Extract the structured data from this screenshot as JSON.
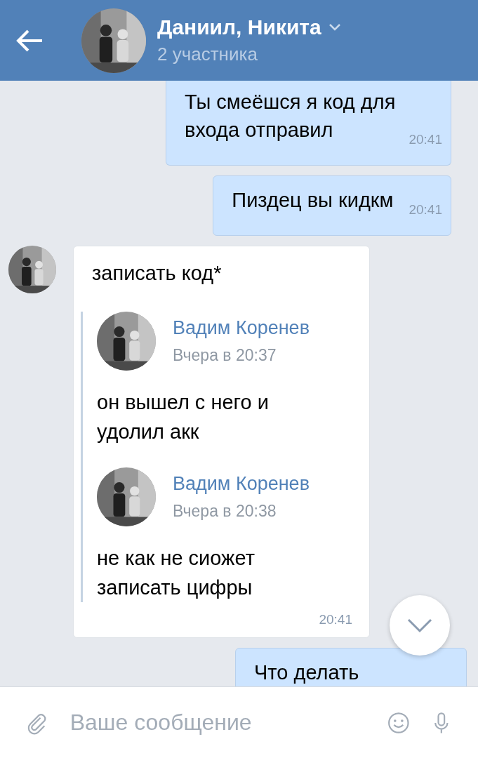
{
  "header": {
    "title": "Даниил, Никита",
    "subtitle": "2 участника"
  },
  "messages": [
    {
      "kind": "outgoing",
      "text": "Ты смеёшся я код для входа отправил",
      "time": "20:41"
    },
    {
      "kind": "outgoing",
      "text": "Пиздец вы кидкм",
      "time": "20:41"
    },
    {
      "kind": "incoming",
      "text": "записать код*",
      "time": "20:41",
      "forwarded": [
        {
          "author": "Вадим Коренев",
          "date": "Вчера в 20:37",
          "text": "он вышел с него и удолил акк"
        },
        {
          "author": "Вадим Коренев",
          "date": "Вчера в 20:38",
          "text": "не как не сиожет записать цифры"
        }
      ]
    },
    {
      "kind": "outgoing",
      "text": "Что делать"
    }
  ],
  "composer": {
    "placeholder": "Ваше сообщение"
  }
}
